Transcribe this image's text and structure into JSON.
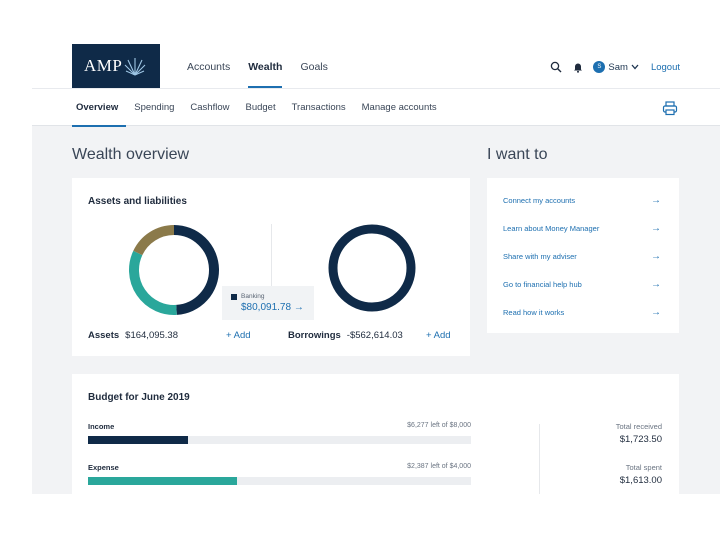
{
  "header": {
    "logo_text": "AMP",
    "nav": [
      {
        "label": "Accounts",
        "active": false
      },
      {
        "label": "Wealth",
        "active": true
      },
      {
        "label": "Goals",
        "active": false
      }
    ],
    "user_initial": "S",
    "user_name": "Sam",
    "logout": "Logout"
  },
  "subnav": {
    "tabs": [
      {
        "label": "Overview",
        "active": true
      },
      {
        "label": "Spending",
        "active": false
      },
      {
        "label": "Cashflow",
        "active": false
      },
      {
        "label": "Budget",
        "active": false
      },
      {
        "label": "Transactions",
        "active": false
      },
      {
        "label": "Manage accounts",
        "active": false
      }
    ]
  },
  "page_title": "Wealth overview",
  "assets_card": {
    "title": "Assets and liabilities",
    "assets_label": "Assets",
    "assets_value": "$164,095.38",
    "borrowings_label": "Borrowings",
    "borrowings_value": "-$562,614.03",
    "add_label": "+ Add",
    "tooltip_label": "Banking",
    "tooltip_value": "$80,091.78 →",
    "assets_donut": [
      {
        "share": 0.49,
        "color": "#0f2a48"
      },
      {
        "share": 0.33,
        "color": "#2aa79b"
      },
      {
        "share": 0.18,
        "color": "#8b7a4a"
      }
    ],
    "borrowings_color": "#0f2a48"
  },
  "iwant": {
    "title": "I want to",
    "items": [
      "Connect my accounts",
      "Learn about Money Manager",
      "Share with my adviser",
      "Go to financial help hub",
      "Read how it works"
    ],
    "arrow": "→"
  },
  "budget": {
    "title": "Budget for June 2019",
    "rows": [
      {
        "label": "Income",
        "left_text": "$6,277 left of $8,000",
        "fraction": 0.26,
        "color": "#0f2a48"
      },
      {
        "label": "Expense",
        "left_text": "$2,387 left of $4,000",
        "fraction": 0.39,
        "color": "#2aa79b"
      }
    ],
    "total_received_label": "Total received",
    "total_received_value": "$1,723.50",
    "total_spent_label": "Total spent",
    "total_spent_value": "$1,613.00"
  }
}
